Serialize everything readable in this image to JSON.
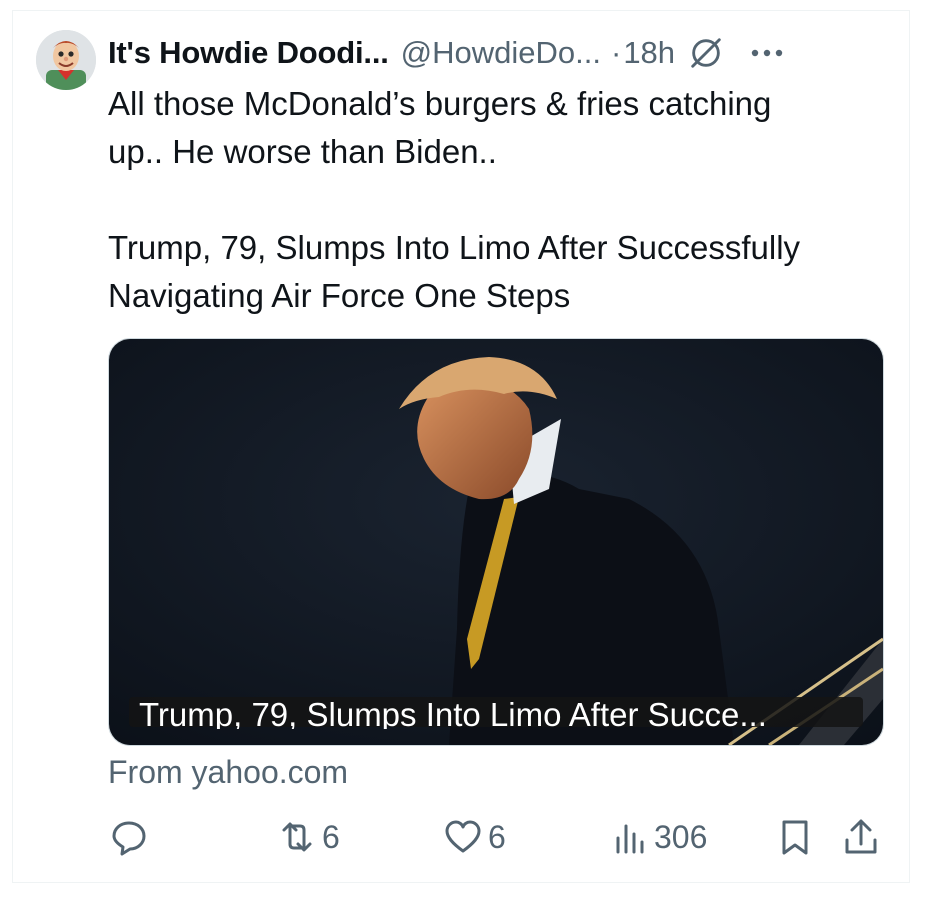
{
  "tweet": {
    "display_name": "It's Howdie Doodi...",
    "handle": "@HowdieDo...",
    "separator": "·",
    "time": "18h",
    "text_line1": "All those McDonald’s burgers & fries catching",
    "text_line2": "up.. He worse than Biden..",
    "text_line3": "Trump, 79, Slumps Into Limo After Successfully",
    "text_line4": "Navigating Air Force One Steps"
  },
  "card": {
    "caption": "Trump, 79, Slumps Into Limo After Succe...",
    "source": "From yahoo.com"
  },
  "actions": {
    "reply_count": "",
    "retweet_count": "6",
    "like_count": "6",
    "views_count": "306"
  },
  "colors": {
    "text": "#0f1419",
    "secondary": "#536471",
    "border": "#cfd9de"
  },
  "icons": [
    "avatar",
    "grok-icon",
    "more-icon",
    "reply-icon",
    "retweet-icon",
    "like-icon",
    "views-icon",
    "bookmark-icon",
    "share-icon"
  ]
}
